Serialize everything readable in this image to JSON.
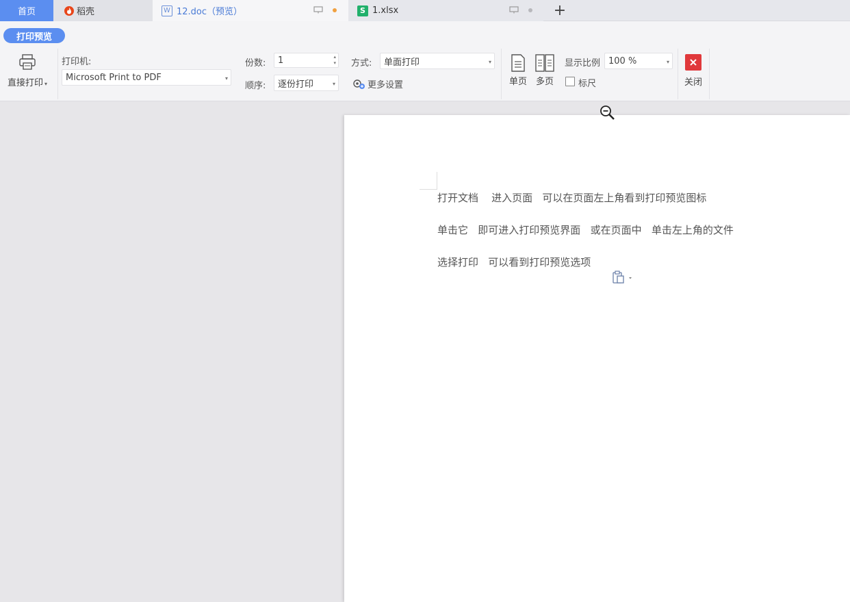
{
  "tabs": {
    "home": "首页",
    "daoke": "稻壳",
    "doc": "12.doc（预览）",
    "xlsx": "1.xlsx",
    "add": "+"
  },
  "ribbon": {
    "mode_pill": "打印预览",
    "direct_print": "直接打印",
    "printer_label": "打印机:",
    "printer_value": "Microsoft Print to PDF",
    "copies_label": "份数:",
    "copies_value": "1",
    "order_label": "顺序:",
    "order_value": "逐份打印",
    "method_label": "方式:",
    "method_value": "单面打印",
    "more_settings": "更多设置",
    "single_page": "单页",
    "multi_page": "多页",
    "zoom_label": "显示比例",
    "zoom_value": "100 %",
    "ruler": "标尺",
    "close": "关闭"
  },
  "document": {
    "lines": [
      "打开文档    进入页面   可以在页面左上角看到打印预览图标",
      "单击它   即可进入打印预览界面   或在页面中   单击左上角的文件",
      "选择打印   可以看到打印预览选项"
    ]
  },
  "colors": {
    "accent": "#5b8ef0",
    "close_red": "#e0383b",
    "xlsx_green": "#21b06b",
    "daoke_orange": "#e8461b"
  }
}
